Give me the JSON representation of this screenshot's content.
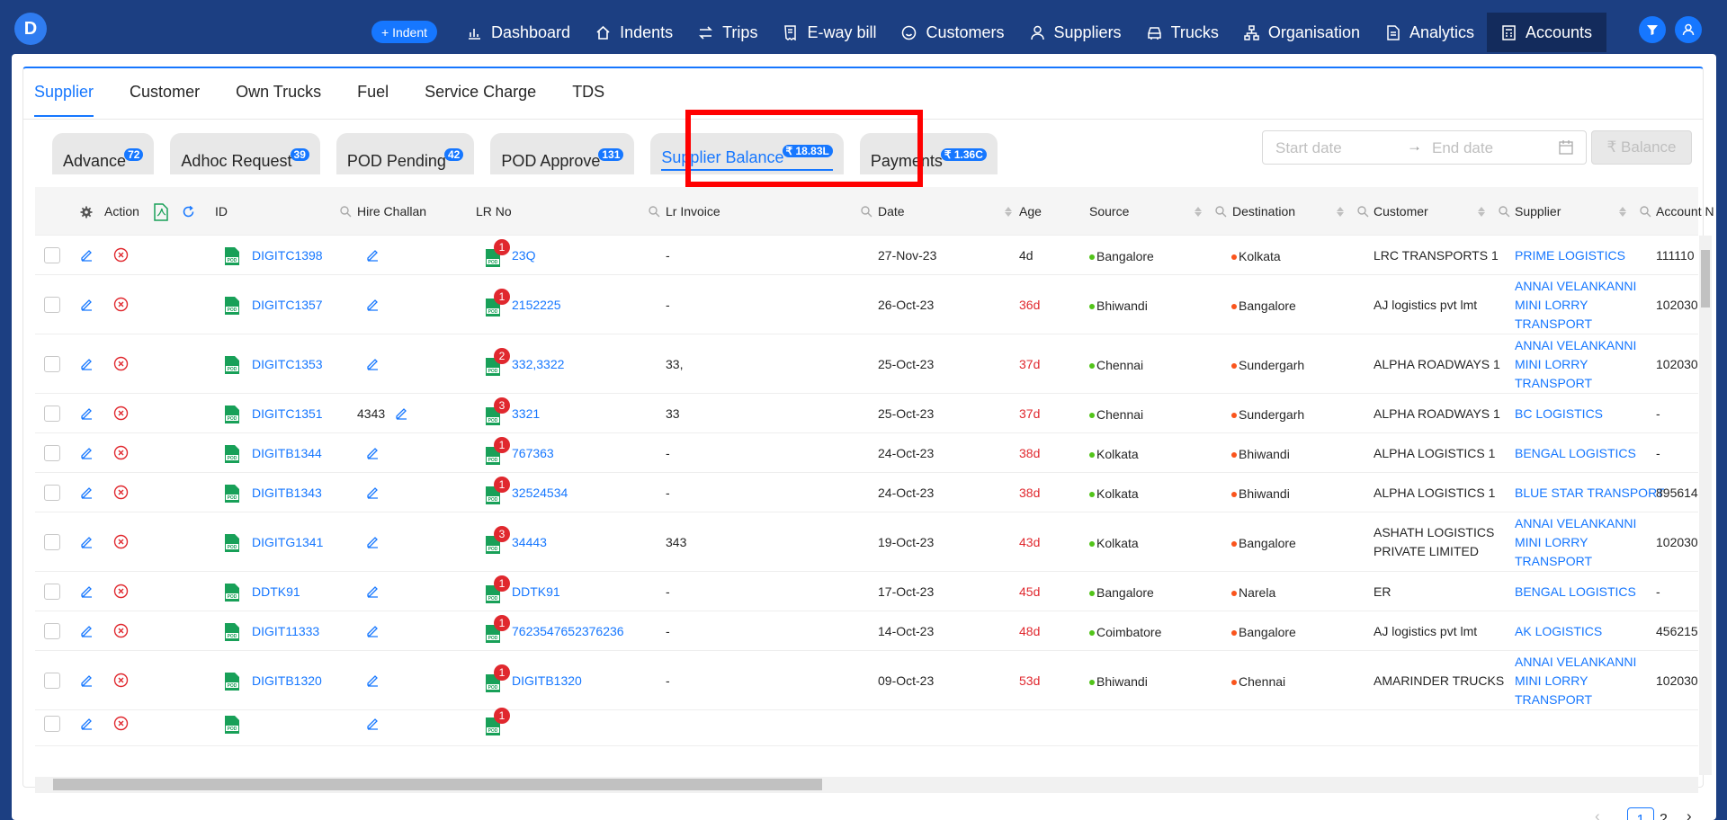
{
  "app": {
    "logo_letter": "D",
    "indent_button": "+ Indent"
  },
  "nav": [
    {
      "label": "Dashboard",
      "icon": "bar-chart-icon"
    },
    {
      "label": "Indents",
      "icon": "home-icon"
    },
    {
      "label": "Trips",
      "icon": "swap-icon"
    },
    {
      "label": "E-way bill",
      "icon": "receipt-icon"
    },
    {
      "label": "Customers",
      "icon": "smile-icon"
    },
    {
      "label": "Suppliers",
      "icon": "user-icon"
    },
    {
      "label": "Trucks",
      "icon": "car-icon"
    },
    {
      "label": "Organisation",
      "icon": "cluster-icon"
    },
    {
      "label": "Analytics",
      "icon": "file-icon"
    },
    {
      "label": "Accounts",
      "icon": "calculator-icon",
      "active": true
    }
  ],
  "tabs": [
    "Supplier",
    "Customer",
    "Own Trucks",
    "Fuel",
    "Service Charge",
    "TDS"
  ],
  "active_tab": "Supplier",
  "subtabs": [
    {
      "label": "Advance",
      "badge": "72"
    },
    {
      "label": "Adhoc Request",
      "badge": "39"
    },
    {
      "label": "POD Pending",
      "badge": "42"
    },
    {
      "label": "POD Approve",
      "badge": "131"
    },
    {
      "label": "Supplier Balance",
      "badge": "₹ 18.83L",
      "active": true
    },
    {
      "label": "Payments",
      "badge": "₹ 1.36C"
    }
  ],
  "filters": {
    "start_placeholder": "Start date",
    "end_placeholder": "End date",
    "balance_button": "₹ Balance"
  },
  "columns": {
    "action": "Action",
    "id": "ID",
    "hire_challan": "Hire Challan",
    "lr_no": "LR No",
    "lr_invoice": "Lr Invoice",
    "date": "Date",
    "age": "Age",
    "source": "Source",
    "destination": "Destination",
    "customer": "Customer",
    "supplier": "Supplier",
    "account": "Account N"
  },
  "rows": [
    {
      "id": "DIGITC1398",
      "hire_challan": "",
      "lr_count": "1",
      "lr_no": "23Q",
      "lr_invoice": "-",
      "date": "27-Nov-23",
      "age": "4d",
      "age_red": false,
      "source": "Bangalore",
      "destination": "Kolkata",
      "customer": [
        "LRC TRANSPORTS 1"
      ],
      "supplier": [
        "PRIME LOGISTICS"
      ],
      "account": "111110"
    },
    {
      "id": "DIGITC1357",
      "hire_challan": "",
      "lr_count": "1",
      "lr_no": "2152225",
      "lr_invoice": "-",
      "date": "26-Oct-23",
      "age": "36d",
      "age_red": true,
      "source": "Bhiwandi",
      "destination": "Bangalore",
      "customer": [
        "AJ logistics pvt lmt"
      ],
      "supplier": [
        "ANNAI VELANKANNI",
        "MINI LORRY",
        "TRANSPORT"
      ],
      "account": "102030"
    },
    {
      "id": "DIGITC1353",
      "hire_challan": "",
      "lr_count": "2",
      "lr_no": "332,3322",
      "lr_invoice": "33,",
      "date": "25-Oct-23",
      "age": "37d",
      "age_red": true,
      "source": "Chennai",
      "destination": "Sundergarh",
      "customer": [
        "ALPHA ROADWAYS 1"
      ],
      "supplier": [
        "ANNAI VELANKANNI",
        "MINI LORRY",
        "TRANSPORT"
      ],
      "account": "102030"
    },
    {
      "id": "DIGITC1351",
      "hire_challan": "4343",
      "lr_count": "3",
      "lr_no": "3321",
      "lr_invoice": "33",
      "date": "25-Oct-23",
      "age": "37d",
      "age_red": true,
      "source": "Chennai",
      "destination": "Sundergarh",
      "customer": [
        "ALPHA ROADWAYS 1"
      ],
      "supplier": [
        "BC LOGISTICS"
      ],
      "account": "-"
    },
    {
      "id": "DIGITB1344",
      "hire_challan": "",
      "lr_count": "1",
      "lr_no": "767363",
      "lr_invoice": "-",
      "date": "24-Oct-23",
      "age": "38d",
      "age_red": true,
      "source": "Kolkata",
      "destination": "Bhiwandi",
      "customer": [
        "ALPHA LOGISTICS 1"
      ],
      "supplier": [
        "BENGAL LOGISTICS"
      ],
      "account": "-"
    },
    {
      "id": "DIGITB1343",
      "hire_challan": "",
      "lr_count": "1",
      "lr_no": "32524534",
      "lr_invoice": "-",
      "date": "24-Oct-23",
      "age": "38d",
      "age_red": true,
      "source": "Kolkata",
      "destination": "Bhiwandi",
      "customer": [
        "ALPHA LOGISTICS 1"
      ],
      "supplier": [
        "BLUE STAR TRANSPORT"
      ],
      "account": "895614"
    },
    {
      "id": "DIGITG1341",
      "hire_challan": "",
      "lr_count": "3",
      "lr_no": "34443",
      "lr_invoice": "343",
      "date": "19-Oct-23",
      "age": "43d",
      "age_red": true,
      "source": "Kolkata",
      "destination": "Bangalore",
      "customer": [
        "ASHATH LOGISTICS",
        "PRIVATE LIMITED"
      ],
      "supplier": [
        "ANNAI VELANKANNI",
        "MINI LORRY",
        "TRANSPORT"
      ],
      "account": "102030"
    },
    {
      "id": "DDTK91",
      "hire_challan": "",
      "lr_count": "1",
      "lr_no": "DDTK91",
      "lr_invoice": "-",
      "date": "17-Oct-23",
      "age": "45d",
      "age_red": true,
      "source": "Bangalore",
      "destination": "Narela",
      "customer": [
        "ER"
      ],
      "supplier": [
        "BENGAL LOGISTICS"
      ],
      "account": "-"
    },
    {
      "id": "DIGIT11333",
      "hire_challan": "",
      "lr_count": "1",
      "lr_no": "7623547652376236",
      "lr_invoice": "-",
      "date": "14-Oct-23",
      "age": "48d",
      "age_red": true,
      "source": "Coimbatore",
      "destination": "Bangalore",
      "customer": [
        "AJ logistics pvt lmt"
      ],
      "supplier": [
        "AK LOGISTICS"
      ],
      "account": "456215"
    },
    {
      "id": "DIGITB1320",
      "hire_challan": "",
      "lr_count": "1",
      "lr_no": "DIGITB1320",
      "lr_invoice": "-",
      "date": "09-Oct-23",
      "age": "53d",
      "age_red": true,
      "source": "Bhiwandi",
      "destination": "Chennai",
      "customer": [
        "AMARINDER TRUCKS"
      ],
      "supplier": [
        "ANNAI VELANKANNI",
        "MINI LORRY",
        "TRANSPORT"
      ],
      "account": "102030"
    },
    {
      "id": "",
      "hire_challan": "",
      "lr_count": "1",
      "lr_no": "",
      "lr_invoice": "",
      "date": "",
      "age": "",
      "age_red": false,
      "source": "",
      "destination": "",
      "customer": [],
      "supplier": [],
      "account": ""
    }
  ],
  "pagination": {
    "current": "1",
    "next_page": "2"
  },
  "colors": {
    "accent": "#1677ff",
    "nav_bg": "#1c3f82",
    "highlight": "#ff0000",
    "danger": "#e0282e",
    "source_dot": "#52c41a",
    "dest_dot": "#fa541c"
  }
}
